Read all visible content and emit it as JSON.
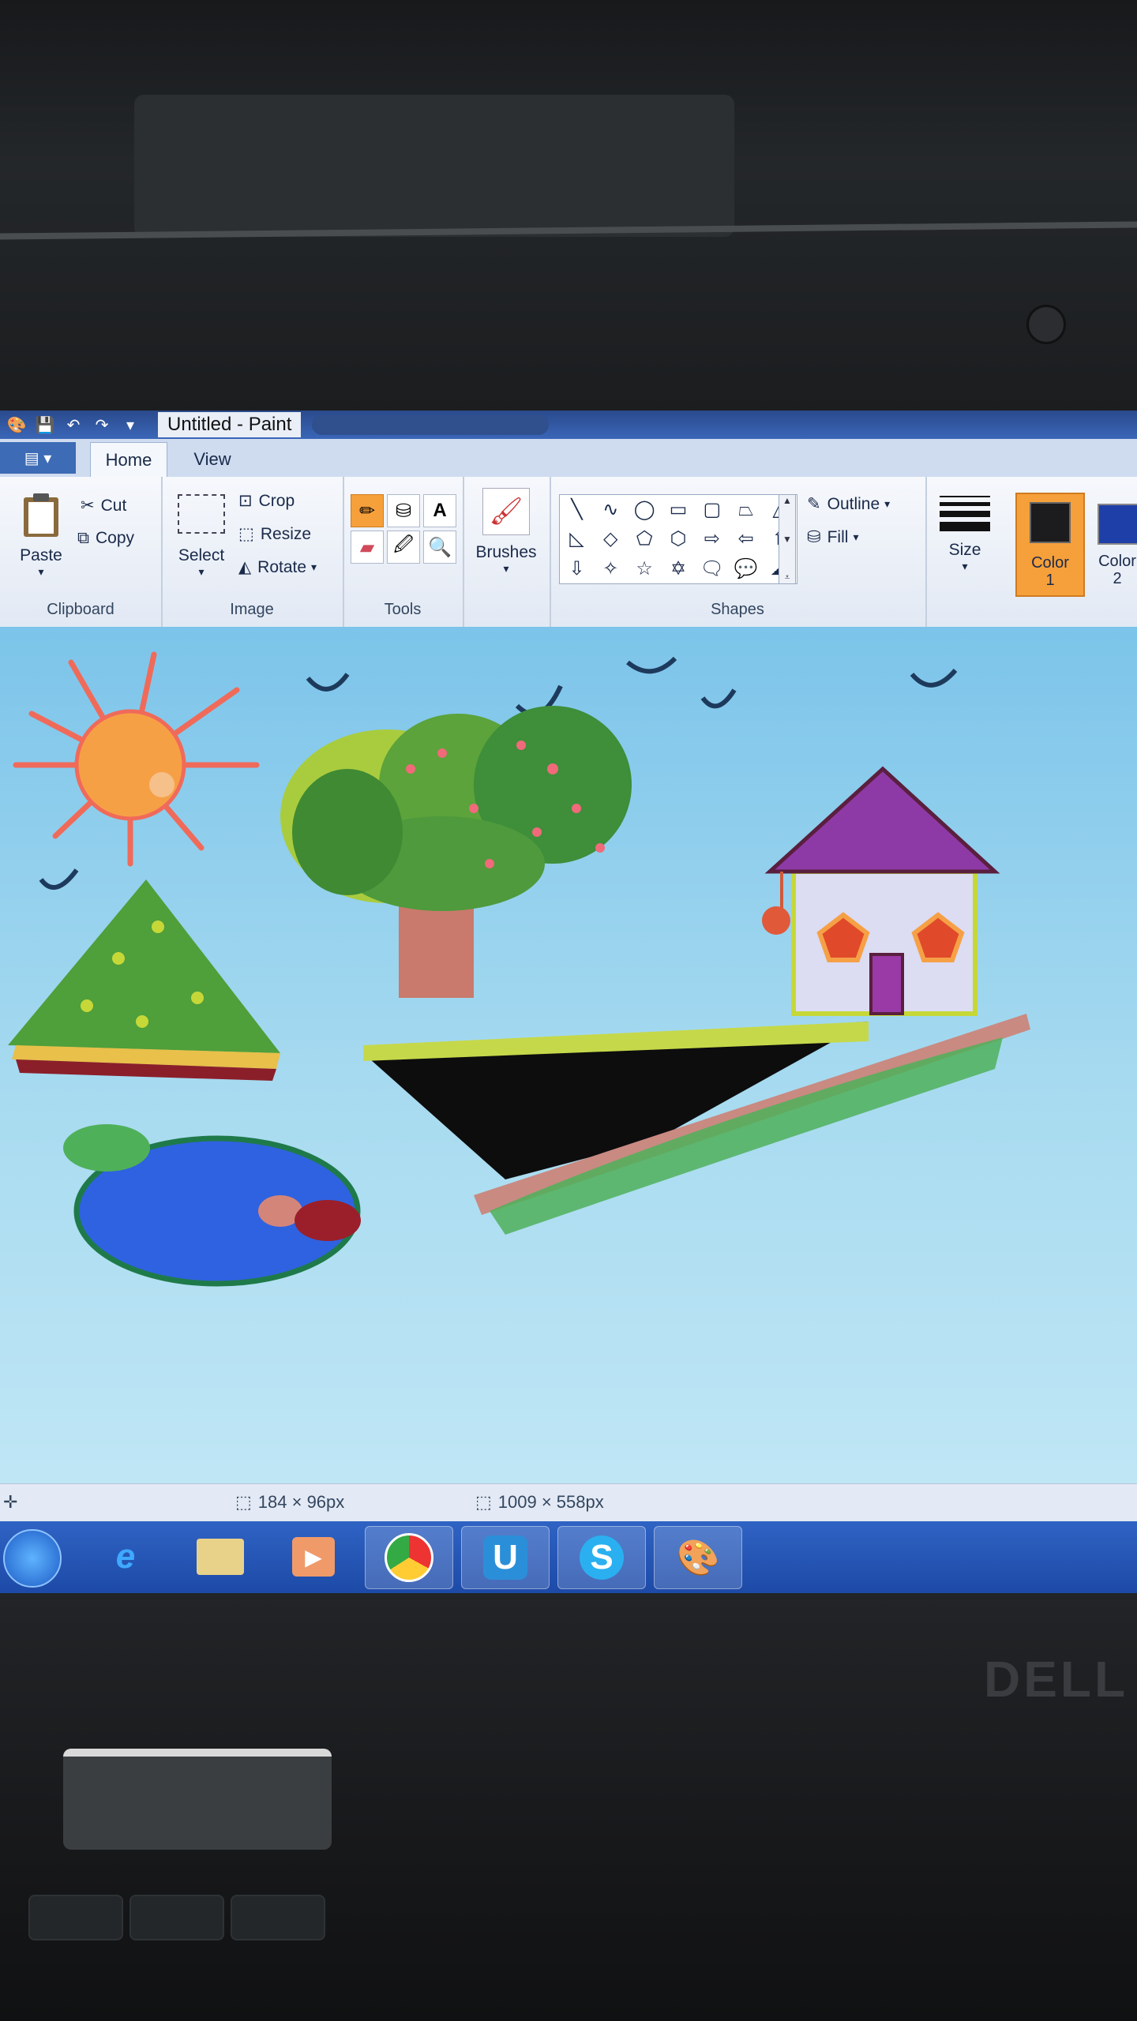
{
  "window": {
    "title": "Untitled - Paint"
  },
  "ribbon_tabs": [
    {
      "label": "Home",
      "active": true
    },
    {
      "label": "View",
      "active": false
    }
  ],
  "clipboard": {
    "paste": "Paste",
    "cut": "Cut",
    "copy": "Copy",
    "group_label": "Clipboard"
  },
  "image": {
    "select": "Select",
    "crop": "Crop",
    "resize": "Resize",
    "rotate": "Rotate",
    "group_label": "Image"
  },
  "tools": {
    "group_label": "Tools",
    "items": [
      "pencil-icon",
      "fill-icon",
      "text-icon",
      "eraser-icon",
      "color-picker-icon",
      "magnifier-icon"
    ]
  },
  "brushes": {
    "label": "Brushes"
  },
  "shapes": {
    "group_label": "Shapes",
    "outline": "Outline",
    "fill": "Fill"
  },
  "size": {
    "label": "Size"
  },
  "colors": {
    "color1_label": "Color",
    "color1_num": "1",
    "color2_label": "Color",
    "color2_num": "2",
    "color1_value": "#1c1c1e",
    "color2_value": "#1f3fa8",
    "accent": "#f6a03b"
  },
  "status": {
    "selection_size": "184 × 96px",
    "canvas_size": "1009 × 558px"
  },
  "taskbar": {
    "items": [
      "start-orb",
      "internet-explorer-icon",
      "file-explorer-icon",
      "media-player-icon",
      "chrome-icon",
      "uplay-icon",
      "skype-icon",
      "paint-icon"
    ]
  }
}
